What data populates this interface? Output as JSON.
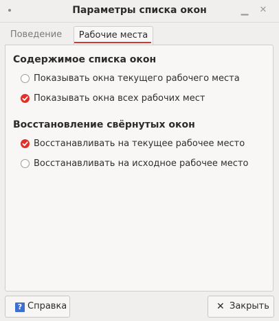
{
  "window": {
    "title": "Параметры списка окон"
  },
  "tabs": [
    {
      "label": "Поведение",
      "selected": false
    },
    {
      "label": "Рабочие места",
      "selected": true
    }
  ],
  "sections": {
    "content": {
      "title": "Содержимое списка окон",
      "options": [
        {
          "label": "Показывать окна текущего рабочего места",
          "checked": false
        },
        {
          "label": "Показывать окна всех рабочих мест",
          "checked": true
        }
      ]
    },
    "restore": {
      "title": "Восстановление свёрнутых окон",
      "options": [
        {
          "label": "Восстанавливать на текущее рабочее место",
          "checked": true
        },
        {
          "label": "Восстанавливать на исходное рабочее место",
          "checked": false
        }
      ]
    }
  },
  "buttons": {
    "help": "Справка",
    "close": "Закрыть"
  },
  "colors": {
    "accent": "#e0302a",
    "help_icon": "#3d6fd2"
  },
  "icons": {
    "help": "question-icon",
    "close": "close-icon",
    "menu": "window-menu-dot-icon"
  }
}
